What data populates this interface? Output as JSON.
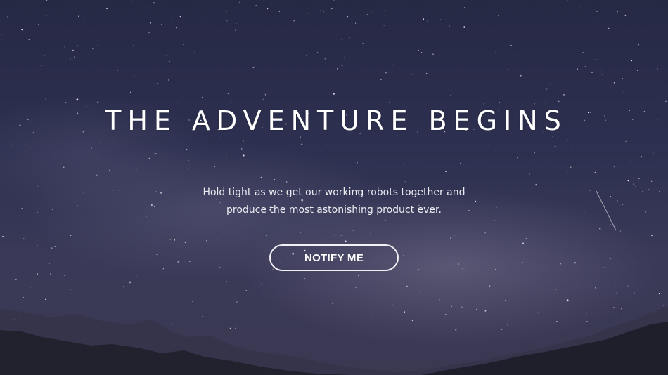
{
  "hero": {
    "title": "THE ADVENTURE BEGINS",
    "subtitle_line1": "Hold tight as we get our working robots together and",
    "subtitle_line2": "produce the most astonishing product ever.",
    "cta_label": "NOTIFY ME"
  },
  "colors": {
    "sky_top": "#262944",
    "sky_bottom": "#3b3852",
    "text": "#ffffff",
    "mountain": "#1f1f2e"
  }
}
